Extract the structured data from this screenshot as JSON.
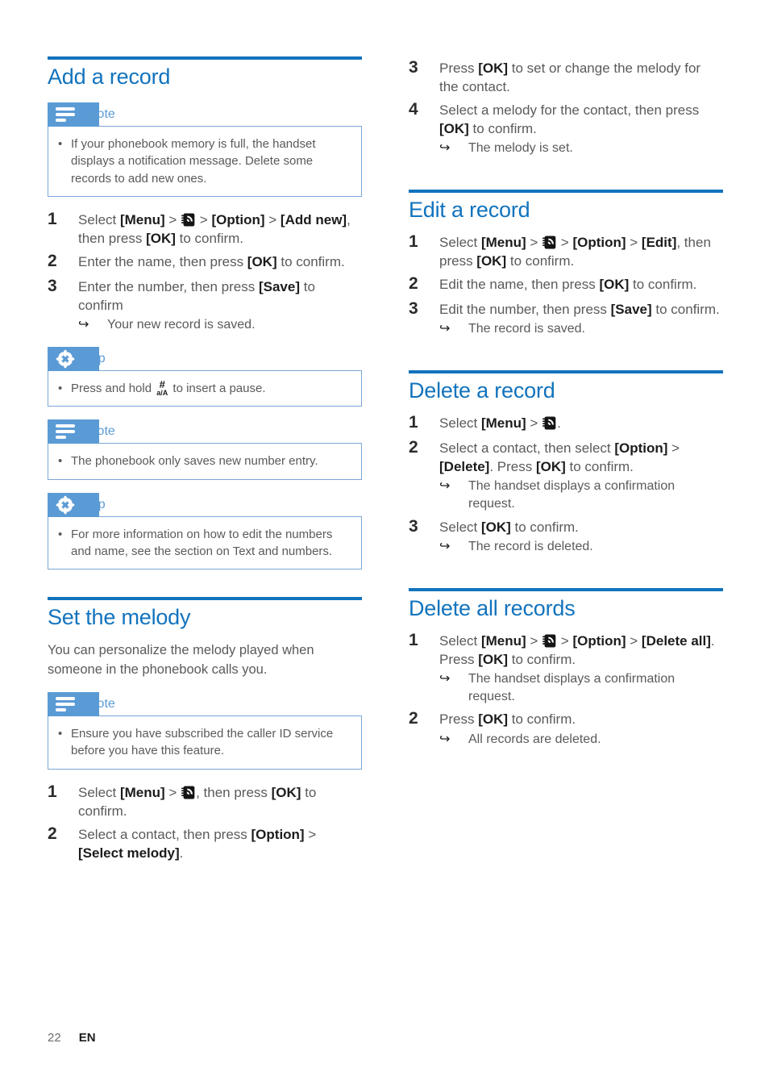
{
  "colors": {
    "heading_blue": "#1273bd",
    "callout_blue": "#5b9bd5",
    "callout_border": "#7ba7d7",
    "body_gray": "#5a5a5a",
    "bold_black": "#1c1c1c"
  },
  "footer": {
    "page_number": "22",
    "language": "EN"
  },
  "left_column": {
    "section_add": {
      "title": "Add a record",
      "note": {
        "label": "Note",
        "icon": "note-lines-icon",
        "items": [
          "If your phonebook memory is full, the handset displays a notification message. Delete some records to add new ones."
        ]
      },
      "steps": [
        {
          "num": "1",
          "parts": [
            {
              "t": "Select "
            },
            {
              "t": "[Menu]",
              "b": true
            },
            {
              "t": " > "
            },
            {
              "icon": "phonebook-icon"
            },
            {
              "t": " > "
            },
            {
              "t": "[Option]",
              "b": true
            },
            {
              "t": " > "
            },
            {
              "t": "[Add new]",
              "b": true
            },
            {
              "t": ", then press "
            },
            {
              "t": "[OK]",
              "b": true
            },
            {
              "t": " to confirm."
            }
          ]
        },
        {
          "num": "2",
          "parts": [
            {
              "t": "Enter the name, then press "
            },
            {
              "t": "[OK]",
              "b": true
            },
            {
              "t": " to confirm."
            }
          ]
        },
        {
          "num": "3",
          "parts": [
            {
              "t": "Enter the number, then press "
            },
            {
              "t": "[Save]",
              "b": true
            },
            {
              "t": " to confirm"
            }
          ],
          "result": "Your new record is saved."
        }
      ],
      "tip1": {
        "label": "Tip",
        "icon": "tip-star-icon",
        "items_parts": [
          [
            {
              "t": "Press and hold "
            },
            {
              "key": {
                "top": "#",
                "bottom": "a/A"
              }
            },
            {
              "t": " to insert a pause."
            }
          ]
        ]
      },
      "note2": {
        "label": "Note",
        "icon": "note-lines-icon",
        "items": [
          "The phonebook only saves new number entry."
        ]
      },
      "tip2": {
        "label": "Tip",
        "icon": "tip-star-icon",
        "items": [
          "For more information on how to edit the numbers and name, see the section on Text and numbers."
        ]
      }
    },
    "section_melody": {
      "title": "Set the melody",
      "intro": "You can personalize the melody played when someone in the phonebook calls you.",
      "note": {
        "label": "Note",
        "icon": "note-lines-icon",
        "items": [
          "Ensure you have subscribed the caller ID service before you have this feature."
        ]
      },
      "steps": [
        {
          "num": "1",
          "parts": [
            {
              "t": "Select "
            },
            {
              "t": "[Menu]",
              "b": true
            },
            {
              "t": " > "
            },
            {
              "icon": "phonebook-icon"
            },
            {
              "t": ", then press "
            },
            {
              "t": "[OK]",
              "b": true
            },
            {
              "t": " to confirm."
            }
          ]
        },
        {
          "num": "2",
          "parts": [
            {
              "t": "Select a contact, then press "
            },
            {
              "t": "[Option]",
              "b": true
            },
            {
              "t": " > "
            },
            {
              "t": "[Select melody]",
              "b": true
            },
            {
              "t": "."
            }
          ]
        }
      ]
    }
  },
  "right_column": {
    "melody_continued": {
      "steps": [
        {
          "num": "3",
          "parts": [
            {
              "t": "Press "
            },
            {
              "t": "[OK]",
              "b": true
            },
            {
              "t": " to set or change the melody for the contact."
            }
          ]
        },
        {
          "num": "4",
          "parts": [
            {
              "t": "Select a melody for the contact, then press "
            },
            {
              "t": "[OK]",
              "b": true
            },
            {
              "t": " to confirm."
            }
          ],
          "result": "The melody is set."
        }
      ]
    },
    "section_edit": {
      "title": "Edit a record",
      "steps": [
        {
          "num": "1",
          "parts": [
            {
              "t": "Select "
            },
            {
              "t": "[Menu]",
              "b": true
            },
            {
              "t": " > "
            },
            {
              "icon": "phonebook-icon"
            },
            {
              "t": " > "
            },
            {
              "t": "[Option]",
              "b": true
            },
            {
              "t": " > "
            },
            {
              "t": "[Edit]",
              "b": true
            },
            {
              "t": ", then press "
            },
            {
              "t": "[OK]",
              "b": true
            },
            {
              "t": " to confirm."
            }
          ]
        },
        {
          "num": "2",
          "parts": [
            {
              "t": "Edit the name, then press "
            },
            {
              "t": "[OK]",
              "b": true
            },
            {
              "t": " to confirm."
            }
          ]
        },
        {
          "num": "3",
          "parts": [
            {
              "t": "Edit the number, then press "
            },
            {
              "t": "[Save]",
              "b": true
            },
            {
              "t": " to confirm."
            }
          ],
          "result": "The record is saved."
        }
      ]
    },
    "section_delete": {
      "title": "Delete a record",
      "steps": [
        {
          "num": "1",
          "parts": [
            {
              "t": "Select "
            },
            {
              "t": "[Menu]",
              "b": true
            },
            {
              "t": " > "
            },
            {
              "icon": "phonebook-icon"
            },
            {
              "t": "."
            }
          ]
        },
        {
          "num": "2",
          "parts": [
            {
              "t": "Select a contact, then select "
            },
            {
              "t": "[Option]",
              "b": true
            },
            {
              "t": " > "
            },
            {
              "t": "[Delete]",
              "b": true
            },
            {
              "t": ". Press "
            },
            {
              "t": "[OK]",
              "b": true
            },
            {
              "t": " to confirm."
            }
          ],
          "result": "The handset displays a confirmation request."
        },
        {
          "num": "3",
          "parts": [
            {
              "t": "Select "
            },
            {
              "t": "[OK]",
              "b": true
            },
            {
              "t": " to confirm."
            }
          ],
          "result": "The record is deleted."
        }
      ]
    },
    "section_delete_all": {
      "title": "Delete all records",
      "steps": [
        {
          "num": "1",
          "parts": [
            {
              "t": "Select "
            },
            {
              "t": "[Menu]",
              "b": true
            },
            {
              "t": " > "
            },
            {
              "icon": "phonebook-icon"
            },
            {
              "t": " > "
            },
            {
              "t": "[Option]",
              "b": true
            },
            {
              "t": " > "
            },
            {
              "t": "[Delete all]",
              "b": true
            },
            {
              "t": ". Press "
            },
            {
              "t": "[OK]",
              "b": true
            },
            {
              "t": " to confirm."
            }
          ],
          "result": "The handset displays a confirmation request."
        },
        {
          "num": "2",
          "parts": [
            {
              "t": "Press "
            },
            {
              "t": "[OK]",
              "b": true
            },
            {
              "t": " to confirm."
            }
          ],
          "result": "All records are deleted."
        }
      ]
    }
  }
}
